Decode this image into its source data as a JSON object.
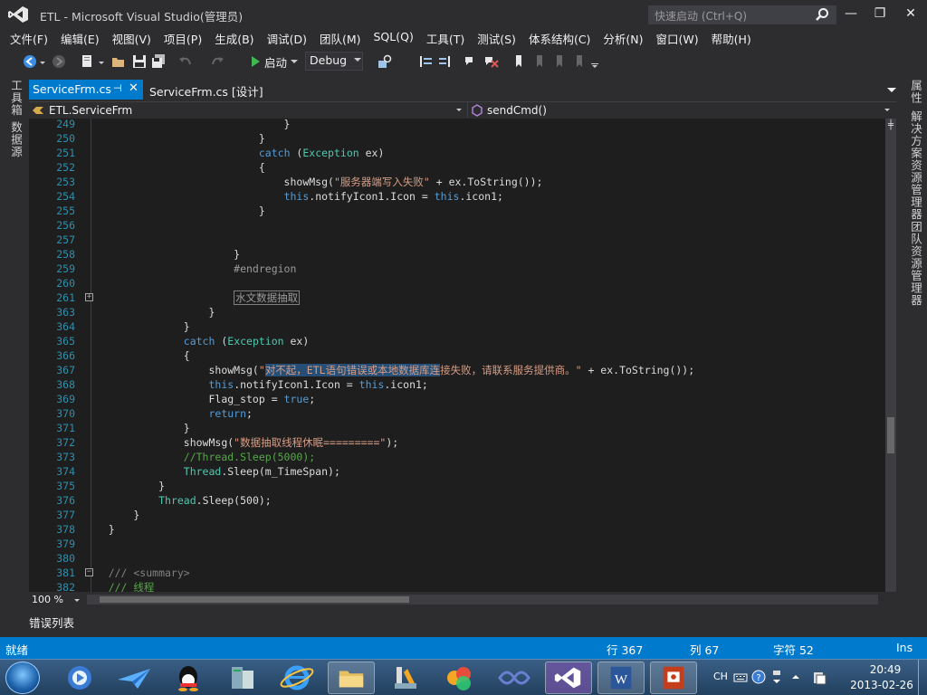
{
  "window": {
    "title": "ETL - Microsoft Visual Studio(管理员)",
    "quick_launch_placeholder": "快速启动 (Ctrl+Q)",
    "minimize": "—",
    "restore": "❐",
    "close": "✕"
  },
  "menu": [
    "文件(F)",
    "编辑(E)",
    "视图(V)",
    "项目(P)",
    "生成(B)",
    "调试(D)",
    "团队(M)",
    "SQL(Q)",
    "工具(T)",
    "测试(S)",
    "体系结构(C)",
    "分析(N)",
    "窗口(W)",
    "帮助(H)"
  ],
  "toolbar": {
    "start_label": "启动",
    "configuration": "Debug"
  },
  "left_panels": [
    "工具箱",
    "数据源"
  ],
  "right_panels": [
    "属性",
    "解决方案资源管理器",
    "团队资源管理器"
  ],
  "tabs": {
    "active": "ServiceFrm.cs",
    "pin_glyph": "⊣",
    "close_glyph": "✕",
    "designer": "ServiceFrm.cs [设计]"
  },
  "nav": {
    "class_name": "ETL.ServiceFrm",
    "member_name": "sendCmd()"
  },
  "code": {
    "lines": [
      {
        "n": "249",
        "text": "                                }"
      },
      {
        "n": "250",
        "text": "                            }"
      },
      {
        "n": "251",
        "text": "                            catch (Exception ex)"
      },
      {
        "n": "252",
        "text": "                            {"
      },
      {
        "n": "253",
        "text": "                                showMsg(\"服务器端写入失败\" + ex.ToString());"
      },
      {
        "n": "254",
        "text": "                                this.notifyIcon1.Icon = this.icon1;"
      },
      {
        "n": "255",
        "text": "                            }"
      },
      {
        "n": "256",
        "text": ""
      },
      {
        "n": "257",
        "text": ""
      },
      {
        "n": "258",
        "text": "                        }"
      },
      {
        "n": "259",
        "text": "                        #endregion"
      },
      {
        "n": "260",
        "text": ""
      },
      {
        "n": "261",
        "text": "水文数据抽取"
      },
      {
        "n": "363",
        "text": "                    }"
      },
      {
        "n": "364",
        "text": "                }"
      },
      {
        "n": "365",
        "text": "                catch (Exception ex)"
      },
      {
        "n": "366",
        "text": "                {"
      },
      {
        "n": "367",
        "text": "                    showMsg(\"对不起，ETL语句错误或本地数据库连接失败，请联系服务提供商。\" + ex.ToString());"
      },
      {
        "n": "368",
        "text": "                    this.notifyIcon1.Icon = this.icon1;"
      },
      {
        "n": "369",
        "text": "                    Flag_stop = true;"
      },
      {
        "n": "370",
        "text": "                    return;"
      },
      {
        "n": "371",
        "text": "                }"
      },
      {
        "n": "372",
        "text": "                showMsg(\"数据抽取线程休眠=========\");"
      },
      {
        "n": "373",
        "text": "                //Thread.Sleep(5000);"
      },
      {
        "n": "374",
        "text": "                Thread.Sleep(m_TimeSpan);"
      },
      {
        "n": "375",
        "text": "            }"
      },
      {
        "n": "376",
        "text": "            Thread.Sleep(500);"
      },
      {
        "n": "377",
        "text": "        }"
      },
      {
        "n": "378",
        "text": "    }"
      },
      {
        "n": "379",
        "text": ""
      },
      {
        "n": "380",
        "text": ""
      },
      {
        "n": "381",
        "text": "    /// <summary>"
      },
      {
        "n": "382",
        "text": "    /// 线程"
      }
    ]
  },
  "zoom": "100 %",
  "error_list_tab": "错误列表",
  "status": {
    "ready": "就绪",
    "line": "行 367",
    "col": "列 67",
    "char": "字符 52",
    "mode": "Ins"
  },
  "taskbar": {
    "ime": "CH",
    "time": "20:49",
    "date": "2013-02-26"
  },
  "colors": {
    "accent": "#007acc",
    "editor_bg": "#1e1e1e",
    "chrome_bg": "#2d2d30"
  }
}
